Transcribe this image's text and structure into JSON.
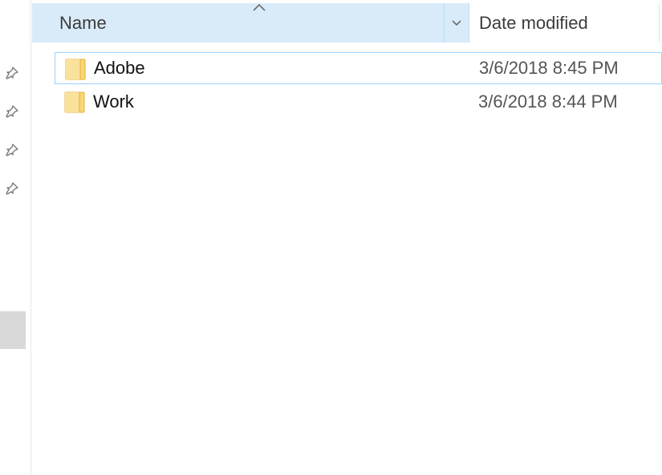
{
  "header": {
    "name_label": "Name",
    "date_label": "Date modified",
    "sort_icon": "chevron-up-icon",
    "dropdown_icon": "chevron-down-icon"
  },
  "nav": {
    "pins": [
      "pin-icon",
      "pin-icon",
      "pin-icon",
      "pin-icon"
    ]
  },
  "files": [
    {
      "name": "Adobe",
      "date_modified": "3/6/2018 8:45 PM",
      "icon": "folder-icon"
    },
    {
      "name": "Work",
      "date_modified": "3/6/2018 8:44 PM",
      "icon": "folder-icon"
    }
  ],
  "colors": {
    "header_highlight": "#d9ebf9",
    "focus_border": "#99d1ff",
    "folder_yellow": "#f8d775"
  }
}
